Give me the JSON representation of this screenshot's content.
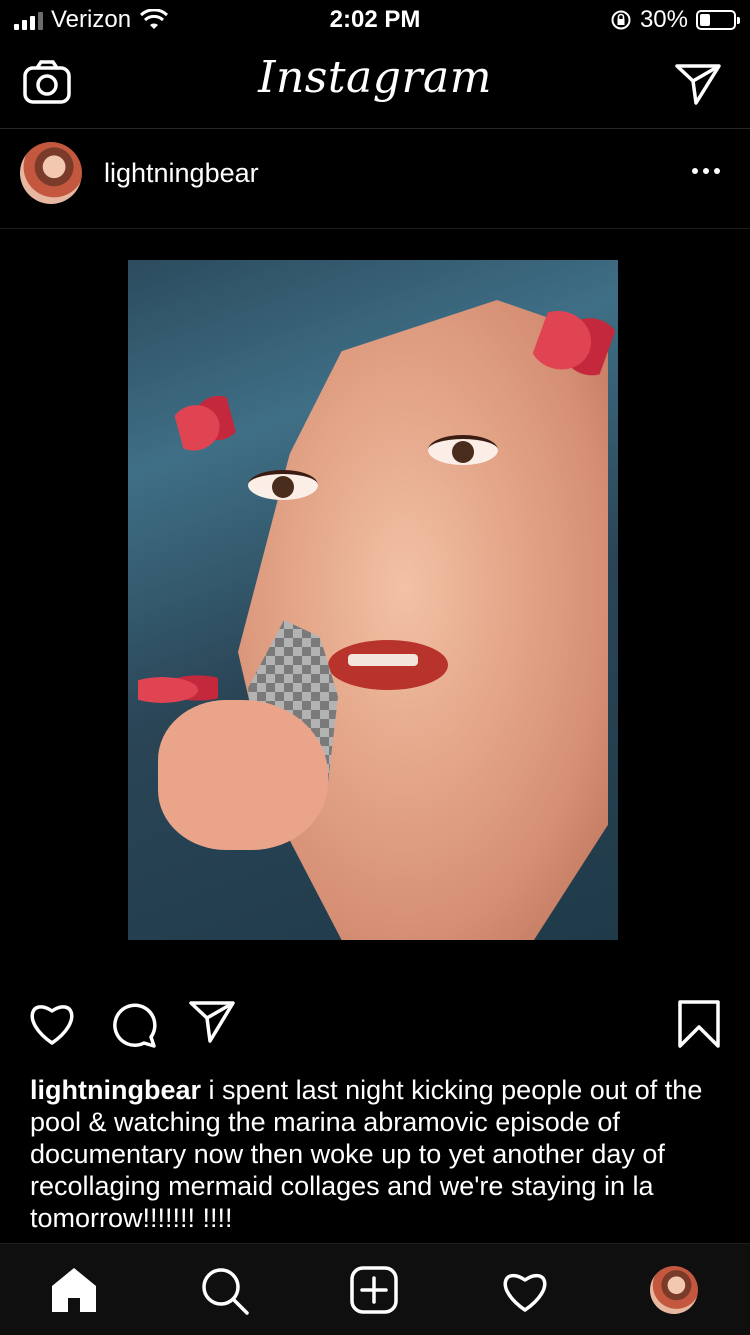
{
  "status_bar": {
    "carrier": "Verizon",
    "time": "2:02 PM",
    "battery_percent": "30%",
    "battery_level": 0.3,
    "signal_bars": 3,
    "icons": [
      "signal-bars-icon",
      "wifi-icon",
      "orientation-lock-icon",
      "battery-icon"
    ]
  },
  "header": {
    "logo": "Instagram",
    "icons": [
      "camera-icon",
      "direct-message-icon"
    ]
  },
  "post": {
    "username": "lightningbear",
    "more_icon": "more-options-icon",
    "image_alt_icons": [
      "collage-image"
    ],
    "actions": [
      "like-heart-icon",
      "comment-icon",
      "share-icon",
      "bookmark-icon"
    ],
    "caption": {
      "username": "lightningbear",
      "text": "i spent last night kicking people out of the pool & watching the marina abramovic episode of documentary now then woke up to yet another day of recollaging mermaid collages and we're staying in la tomorrow!!!!!!! !!!!"
    }
  },
  "tab_bar": {
    "items": [
      "home-icon",
      "search-icon",
      "new-post-icon",
      "activity-heart-icon",
      "profile-avatar"
    ]
  },
  "colors": {
    "background": "#000000",
    "text": "#ffffff",
    "divider": "#262626"
  }
}
